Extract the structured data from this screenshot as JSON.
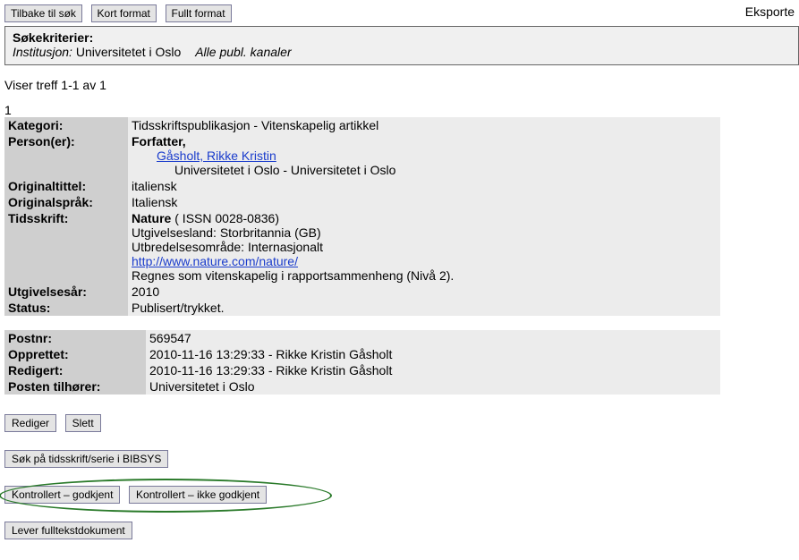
{
  "topbar": {
    "back": "Tilbake til søk",
    "short": "Kort format",
    "full": "Fullt format",
    "export": "Eksporte"
  },
  "criteria": {
    "title": "Søkekriterier:",
    "inst_label": "Institusjon:",
    "inst_value": "Universitetet i Oslo",
    "channels": "Alle publ. kanaler"
  },
  "hits": "Viser treff 1-1 av 1",
  "record_num": "1",
  "rec": {
    "kategori_label": "Kategori:",
    "kategori": "Tidsskriftspublikasjon - Vitenskapelig artikkel",
    "personer_label": "Person(er):",
    "forfatter_label": "Forfatter,",
    "forfatter_link": "Gåsholt, Rikke Kristin",
    "affil": "Universitetet i Oslo - Universitetet i Oslo",
    "origtittel_label": "Originaltittel:",
    "origtittel": "italiensk",
    "origsprak_label": "Originalspråk:",
    "origsprak": "Italiensk",
    "tidsskrift_label": "Tidsskrift:",
    "tidsskrift_name": "Nature",
    "tidsskrift_issn": " ( ISSN 0028-0836)",
    "tidsskrift_country": "Utgivelsesland: Storbritannia (GB)",
    "tidsskrift_area": "Utbredelsesområde: Internasjonalt",
    "tidsskrift_url": "http://www.nature.com/nature/",
    "tidsskrift_level": "Regnes som vitenskapelig i rapportsammenheng (Nivå 2).",
    "aar_label": "Utgivelsesår:",
    "aar": "2010",
    "status_label": "Status:",
    "status": "Publisert/trykket.",
    "postnr_label": "Postnr:",
    "postnr": "569547",
    "opprettet_label": "Opprettet:",
    "opprettet": "2010-11-16 13:29:33 - Rikke Kristin Gåsholt",
    "redigert_label": "Redigert:",
    "redigert": "2010-11-16 13:29:33 - Rikke Kristin Gåsholt",
    "tilhorer_label": "Posten tilhører:",
    "tilhorer": "Universitetet i Oslo"
  },
  "actions": {
    "rediger": "Rediger",
    "slett": "Slett",
    "bibsys": "Søk på tidsskrift/serie i BIBSYS",
    "godkjent": "Kontrollert – godkjent",
    "ikke_godkjent": "Kontrollert – ikke godkjent",
    "lever": "Lever fulltekstdokument"
  }
}
